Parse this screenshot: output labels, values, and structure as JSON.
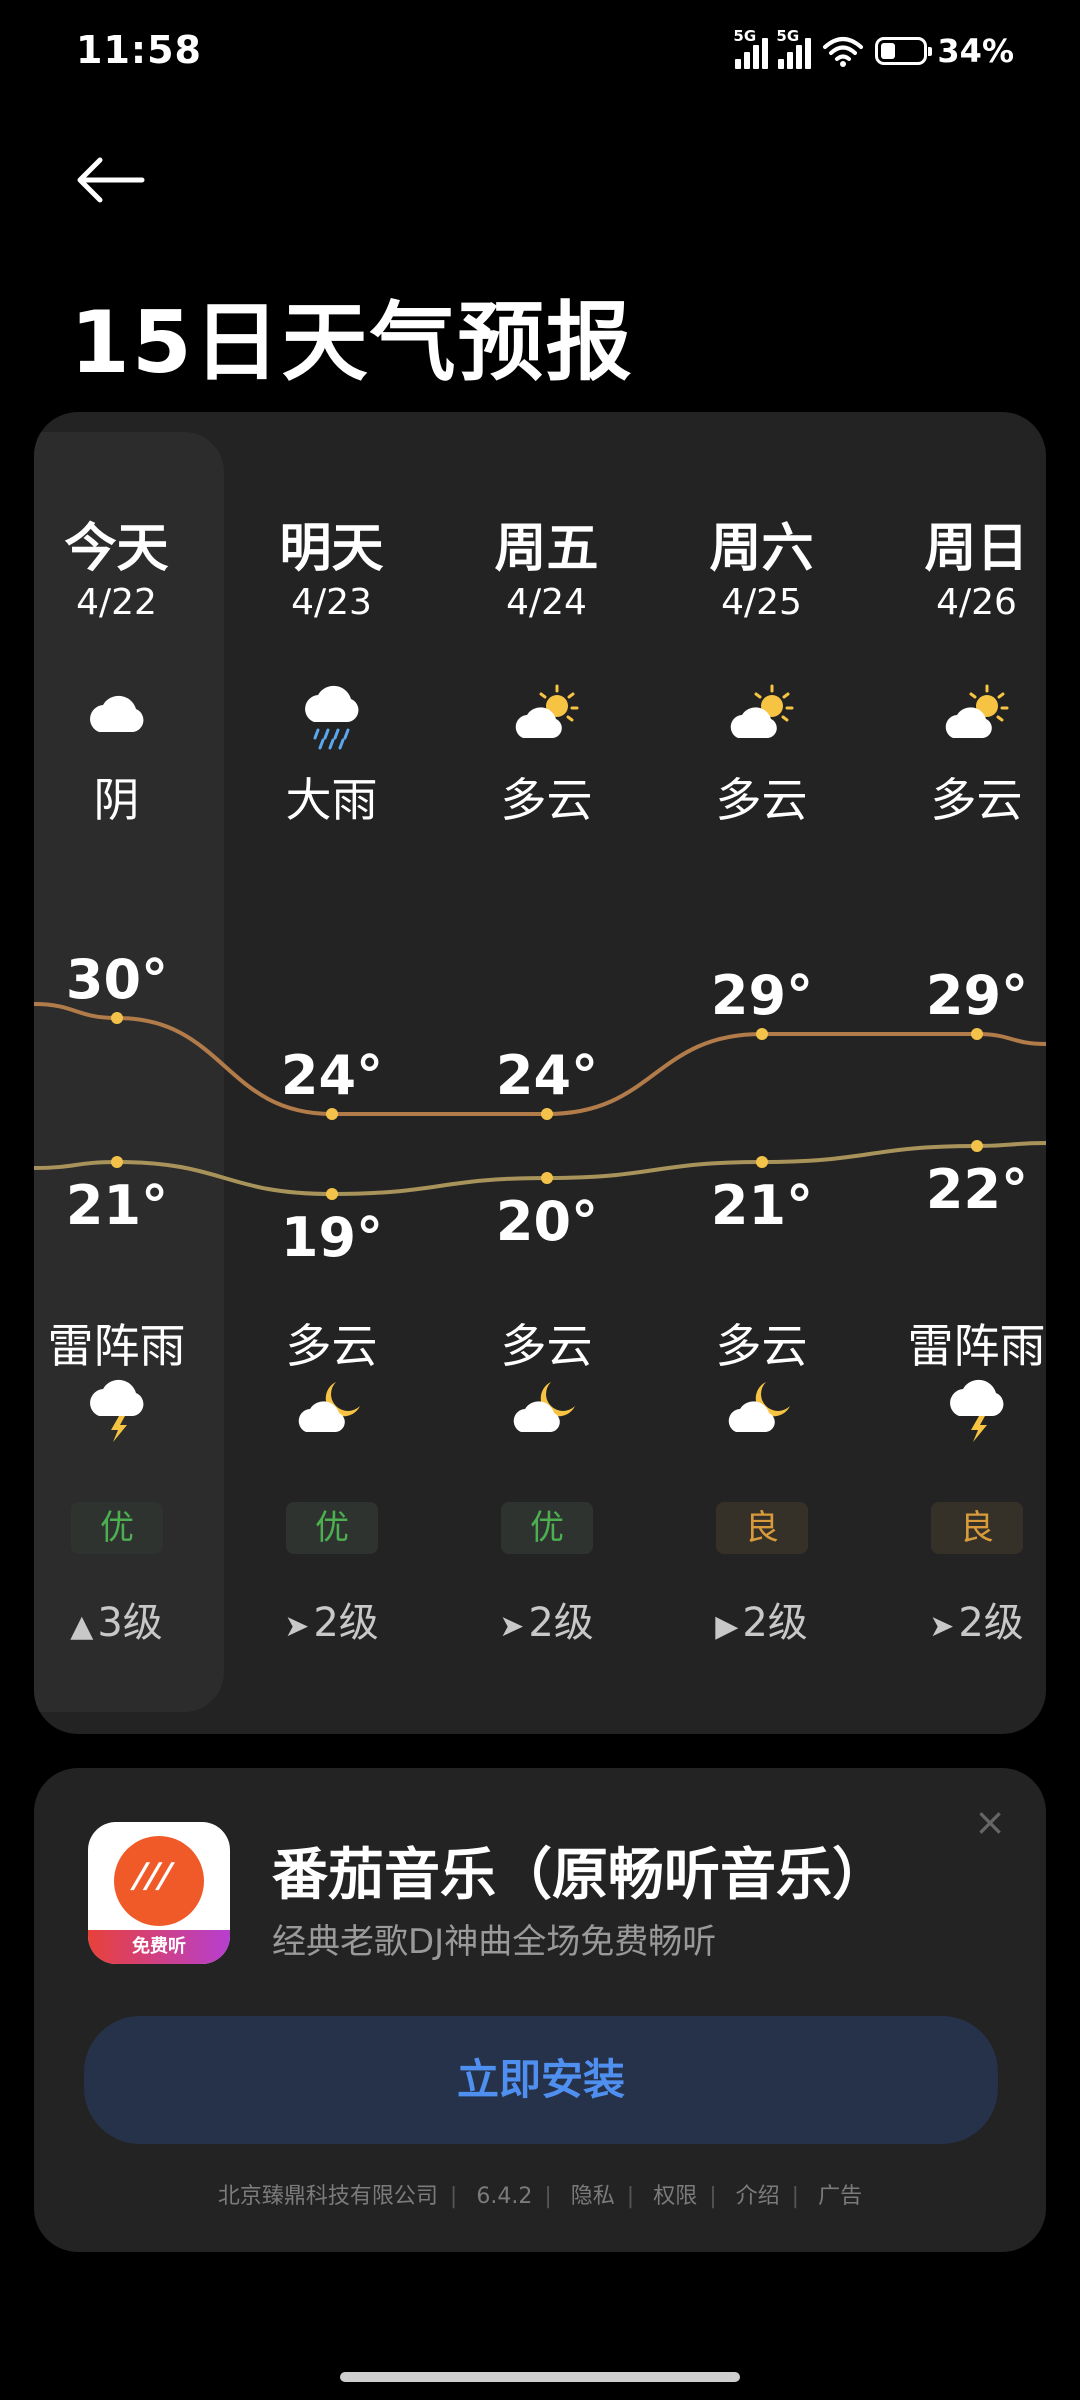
{
  "status_bar": {
    "time": "11:58",
    "net1": "5G",
    "net2": "5G",
    "battery_text": "34%",
    "battery_level": 0.34
  },
  "page": {
    "title": "15日天气预报"
  },
  "forecast": {
    "days": [
      {
        "name": "今天",
        "date": "4/22",
        "day_weather": "阴",
        "day_icon": "cloud-icon",
        "high": "30°",
        "low": "21°",
        "night_weather": "雷阵雨",
        "night_icon": "thunderstorm-icon",
        "aqi": "优",
        "aqi_level": "good",
        "wind": "3级",
        "wind_arrow": "▲"
      },
      {
        "name": "明天",
        "date": "4/23",
        "day_weather": "大雨",
        "day_icon": "heavy-rain-icon",
        "high": "24°",
        "low": "19°",
        "night_weather": "多云",
        "night_icon": "cloudy-night-icon",
        "aqi": "优",
        "aqi_level": "good",
        "wind": "2级",
        "wind_arrow": "➤"
      },
      {
        "name": "周五",
        "date": "4/24",
        "day_weather": "多云",
        "day_icon": "partly-cloudy-day-icon",
        "high": "24°",
        "low": "20°",
        "night_weather": "多云",
        "night_icon": "cloudy-night-icon",
        "aqi": "优",
        "aqi_level": "good",
        "wind": "2级",
        "wind_arrow": "➤"
      },
      {
        "name": "周六",
        "date": "4/25",
        "day_weather": "多云",
        "day_icon": "partly-cloudy-day-icon",
        "high": "29°",
        "low": "21°",
        "night_weather": "多云",
        "night_icon": "cloudy-night-icon",
        "aqi": "良",
        "aqi_level": "moderate",
        "wind": "2级",
        "wind_arrow": "▶"
      },
      {
        "name": "周日",
        "date": "4/26",
        "day_weather": "多云",
        "day_icon": "partly-cloudy-day-icon",
        "high": "29°",
        "low": "22°",
        "night_weather": "雷阵雨",
        "night_icon": "thunderstorm-icon",
        "aqi": "良",
        "aqi_level": "moderate",
        "wind": "2级",
        "wind_arrow": "➤"
      }
    ],
    "high_values": [
      30,
      24,
      24,
      29,
      29
    ],
    "low_values": [
      21,
      19,
      20,
      21,
      22
    ],
    "colors": {
      "high_line": "#b27c4a",
      "low_line": "#a8935a",
      "dot": "#f2c24a"
    }
  },
  "ad": {
    "app_name": "番茄音乐（原畅听音乐）",
    "description": "经典老歌DJ神曲全场免费畅听",
    "icon_badge": "免费听",
    "install_label": "立即安装",
    "close_label": "×",
    "footer": {
      "company": "北京臻鼎科技有限公司",
      "version": "6.4.2",
      "privacy": "隐私",
      "permissions": "权限",
      "intro": "介绍",
      "ad": "广告"
    }
  }
}
